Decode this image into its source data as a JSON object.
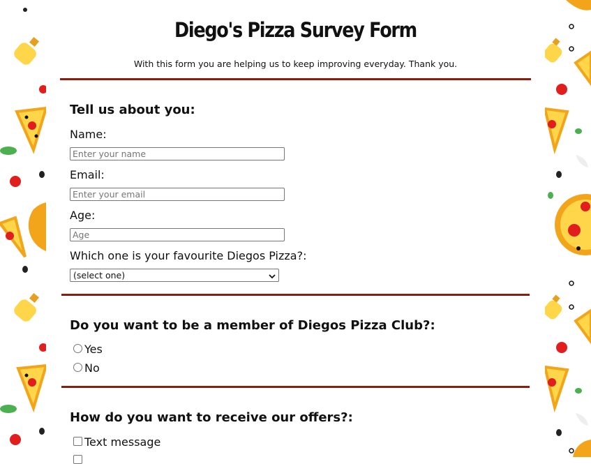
{
  "header": {
    "title": "Diego's Pizza Survey Form",
    "description": "With this form you are helping us to keep improving everyday. Thank you."
  },
  "about": {
    "heading": "Tell us about you:",
    "name_label": "Name:",
    "name_placeholder": "Enter your name",
    "email_label": "Email:",
    "email_placeholder": "Enter your email",
    "age_label": "Age:",
    "age_placeholder": "Age",
    "favourite_label": "Which one is your favourite Diegos Pizza?:",
    "favourite_selected": "(select one)"
  },
  "club": {
    "heading": "Do you want to be a member of Diegos Pizza Club?:",
    "options": [
      "Yes",
      "No"
    ]
  },
  "offers": {
    "heading": "How do you want to receive our offers?:",
    "options": [
      "Text message"
    ]
  },
  "colors": {
    "rule": "#8b1c0e",
    "pizza_crust": "#f2a51a",
    "pizza_cheese": "#ffd64a",
    "tomato": "#e11d1d",
    "basil": "#4caf50"
  },
  "icons": [
    "pizza-slice-icon",
    "oil-bottle-icon",
    "tomato-icon",
    "olive-icon",
    "basil-leaf-icon",
    "whole-pizza-icon",
    "chevron-down-icon"
  ]
}
